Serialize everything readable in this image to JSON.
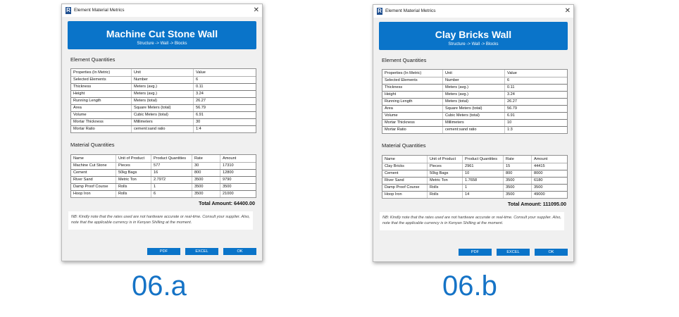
{
  "colors": {
    "accent": "#0a74c9",
    "caption": "#1573c6"
  },
  "common": {
    "window_title": "Element Material Metrics",
    "app_icon_letter": "R",
    "close_glyph": "✕",
    "element_quantities_heading": "Element Quantities",
    "material_quantities_heading": "Material Quantities",
    "element_columns": [
      "Properties (In Metric)",
      "Unit",
      "Value"
    ],
    "material_columns": [
      "Name",
      "Unit of Product",
      "Product Quantities",
      "Rate",
      "Amount"
    ],
    "note": "NB: Kindly note that the rates used are not hardware accurate or real-time. Consult your supplier. Also, note that the applicable currency is in Kenyan Shilling at the moment.",
    "buttons": {
      "pdf": "PDF",
      "excel": "EXCEL",
      "ok": "OK"
    }
  },
  "dialogs": [
    {
      "wall_title": "Machine Cut Stone Wall",
      "breadcrumb": "Structure -> Wall -> Blocks",
      "element_rows": [
        [
          "Selected Elements",
          "Number",
          "6"
        ],
        [
          "Thickness",
          "Meters (avg.)",
          "0.11"
        ],
        [
          "Height",
          "Meters (avg.)",
          "3.24"
        ],
        [
          "Running Length",
          "Meters (total)",
          "26.27"
        ],
        [
          "Area",
          "Square Meters (total)",
          "56.79"
        ],
        [
          "Volume",
          "Cubic Meters (total)",
          "6.91"
        ],
        [
          "Mortar Thickness",
          "Millimeters",
          "30"
        ],
        [
          "Mortar Ratio",
          "cement:sand ratio",
          "1:4"
        ]
      ],
      "material_rows": [
        [
          "Machine Cut Stone",
          "Pieces",
          "577",
          "30",
          "17310"
        ],
        [
          "Cement",
          "50kg Bags",
          "16",
          "800",
          "12800"
        ],
        [
          "River Sand",
          "Metric Ton",
          "2.7972",
          "3500",
          "9790"
        ],
        [
          "Damp Proof Course",
          "Rolls",
          "1",
          "3500",
          "3500"
        ],
        [
          "Hoop Iron",
          "Rolls",
          "6",
          "3500",
          "21000"
        ]
      ],
      "total": "Total Amount: 64400.00",
      "caption": "06.a"
    },
    {
      "wall_title": "Clay Bricks Wall",
      "breadcrumb": "Structure -> Wall -> Blocks",
      "element_rows": [
        [
          "Selected Elements",
          "Number",
          "6"
        ],
        [
          "Thickness",
          "Meters (avg.)",
          "0.11"
        ],
        [
          "Height",
          "Meters (avg.)",
          "3.24"
        ],
        [
          "Running Length",
          "Meters (total)",
          "26.27"
        ],
        [
          "Area",
          "Square Meters (total)",
          "56.79"
        ],
        [
          "Volume",
          "Cubic Meters (total)",
          "6.91"
        ],
        [
          "Mortar Thickness",
          "Millimeters",
          "10"
        ],
        [
          "Mortar Ratio",
          "cement:sand ratio",
          "1:3"
        ]
      ],
      "material_rows": [
        [
          "Clay Bricks",
          "Pieces",
          "2961",
          "15",
          "44415"
        ],
        [
          "Cement",
          "50kg Bags",
          "10",
          "800",
          "8000"
        ],
        [
          "River Sand",
          "Metric Ton",
          "1.7658",
          "3500",
          "6180"
        ],
        [
          "Damp Proof Course",
          "Rolls",
          "1",
          "3500",
          "3500"
        ],
        [
          "Hoop Iron",
          "Rolls",
          "14",
          "3500",
          "49000"
        ]
      ],
      "total": "Total Amount: 111095.00",
      "caption": "06.b"
    }
  ]
}
